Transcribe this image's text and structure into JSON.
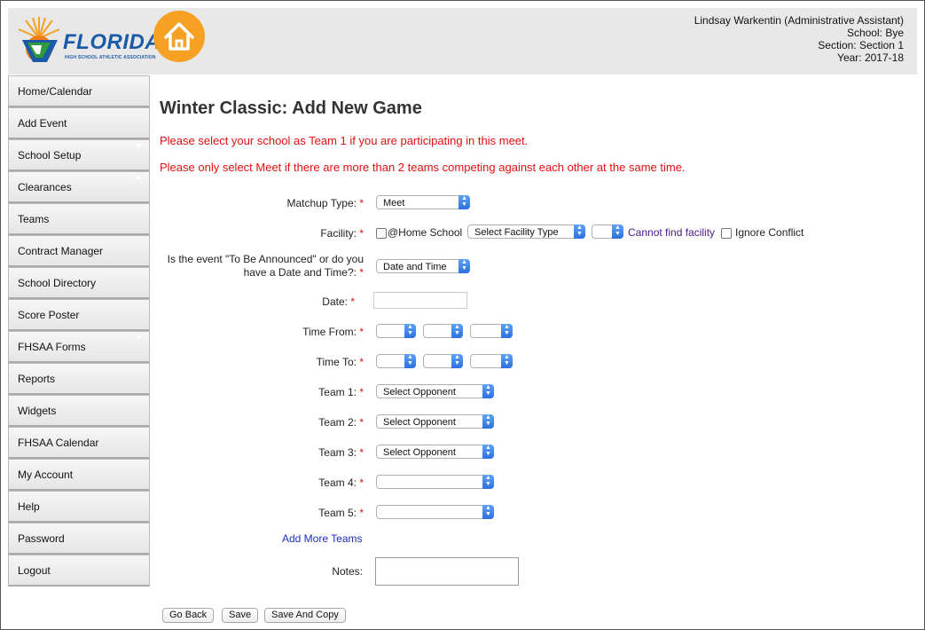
{
  "header": {
    "logo_text": "FLORIDA",
    "logo_subtext": "HIGH SCHOOL ATHLETIC ASSOCIATION",
    "user_name": "Lindsay Warkentin (Administrative Assistant)",
    "school": "School: Bye",
    "section": "Section: Section 1",
    "year": "Year: 2017-18"
  },
  "sidebar": {
    "items": [
      {
        "label": "Home/Calendar",
        "has_submenu": false
      },
      {
        "label": "Add Event",
        "has_submenu": false
      },
      {
        "label": "School Setup",
        "has_submenu": true
      },
      {
        "label": "Clearances",
        "has_submenu": true
      },
      {
        "label": "Teams",
        "has_submenu": false
      },
      {
        "label": "Contract Manager",
        "has_submenu": false
      },
      {
        "label": "School Directory",
        "has_submenu": false
      },
      {
        "label": "Score Poster",
        "has_submenu": false
      },
      {
        "label": "FHSAA Forms",
        "has_submenu": true
      },
      {
        "label": "Reports",
        "has_submenu": false
      },
      {
        "label": "Widgets",
        "has_submenu": false
      },
      {
        "label": "FHSAA Calendar",
        "has_submenu": false
      },
      {
        "label": "My Account",
        "has_submenu": false
      },
      {
        "label": "Help",
        "has_submenu": false
      },
      {
        "label": "Password",
        "has_submenu": false
      },
      {
        "label": "Logout",
        "has_submenu": false
      }
    ]
  },
  "main": {
    "title": "Winter Classic: Add New Game",
    "notice1": "Please select your school as Team 1 if you are participating in this meet.",
    "notice2": "Please only select Meet if there are more than 2 teams competing against each other at the same time."
  },
  "form": {
    "matchup_label": "Matchup Type:",
    "matchup_value": "Meet",
    "facility_label": "Facility:",
    "home_school_label": "@Home School",
    "facility_type_value": "Select Facility Type",
    "facility_value": "",
    "cannot_find_facility": "Cannot find facility",
    "ignore_conflict_label": "Ignore Conflict",
    "tba_label_line1": "Is the event \"To Be Announced\" or do you",
    "tba_label_line2": "have a Date and Time?:",
    "tba_value": "Date and Time",
    "date_label": "Date:",
    "date_value": "",
    "time_from_label": "Time From:",
    "time_to_label": "Time To:",
    "team1_label": "Team 1:",
    "team1_value": "Select Opponent",
    "team2_label": "Team 2:",
    "team2_value": "Select Opponent",
    "team3_label": "Team 3:",
    "team3_value": "Select Opponent",
    "team4_label": "Team 4:",
    "team4_value": "",
    "team5_label": "Team 5:",
    "team5_value": "",
    "add_more_teams": "Add More Teams",
    "notes_label": "Notes:",
    "notes_value": "",
    "required_marker": "*"
  },
  "buttons": {
    "go_back": "Go Back",
    "save": "Save",
    "save_and_copy": "Save And Copy"
  },
  "colors": {
    "required": "#e21010",
    "notice": "#e21010",
    "link": "#1c2fc0",
    "home_button": "#f6a024",
    "header_bg": "#e8e8e8"
  }
}
